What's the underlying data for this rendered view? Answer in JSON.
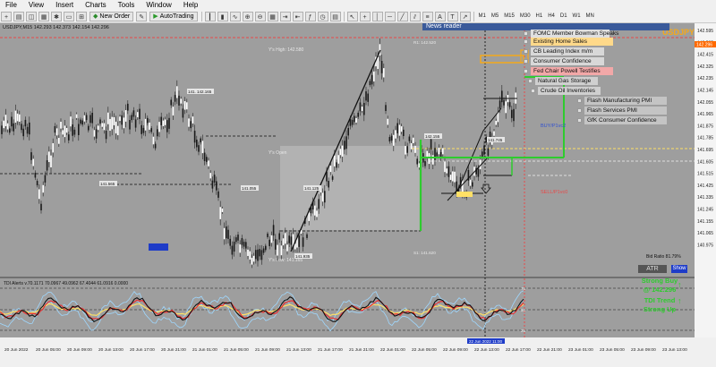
{
  "menu": [
    "File",
    "View",
    "Insert",
    "Charts",
    "Tools",
    "Window",
    "Help"
  ],
  "toolbar": {
    "new_order": "New Order",
    "autotrading": "AutoTrading",
    "timeframes": [
      "M1",
      "M5",
      "M15",
      "M30",
      "H1",
      "H4",
      "D1",
      "W1",
      "MN"
    ]
  },
  "chart": {
    "title": "USDJPY,M15  142.293 142.373 142.154 142.296",
    "symbol_watermark": "USDJPY",
    "prices": [
      "142.595",
      "142.505",
      "142.415",
      "142.325",
      "142.235",
      "142.145",
      "142.055",
      "141.965",
      "141.875",
      "141.785",
      "141.695",
      "141.605",
      "141.515",
      "141.425",
      "141.335",
      "141.245",
      "141.155",
      "141.065",
      "140.975"
    ],
    "price_tag": "142.296",
    "times": [
      "20 Jun 2022",
      "20 Jun 05:00",
      "20 Jun 09:00",
      "20 Jun 13:00",
      "20 Jun 17:00",
      "20 Jun 21:00",
      "21 Jun 01:00",
      "21 Jun 05:00",
      "21 Jun 09:00",
      "21 Jun 13:00",
      "21 Jun 17:00",
      "21 Jun 21:00",
      "22 Jun 01:00",
      "22 Jun 05:00",
      "22 Jun 09:00",
      "22 Jun 13:00",
      "22 Jun 17:00",
      "22 Jun 21:00",
      "23 Jun 01:00",
      "23 Jun 05:00",
      "23 Jun 09:00",
      "23 Jun 13:00"
    ],
    "levels": {
      "y_high": "Y's High: 142.580",
      "y_open": "Y's Open",
      "y_low": "Y's Low: 141.165",
      "r1": "R1: 142.520",
      "s1": "S1: 141.620",
      "buy": "BUY/P1vc2",
      "sell": "SELL/P1vc0",
      "bid_ratio": "Bid Ratio 81.79%"
    },
    "tags": [
      "141.565",
      "141.805",
      "142.165",
      "142.155",
      "141.745",
      "141.935",
      "141.055",
      "141.125"
    ],
    "cursor_time": "22 Jun 2022 11:00"
  },
  "news": {
    "title": "News reader",
    "items": [
      "FOMC Member Bowman Speaks",
      "Existing Home Sales",
      "CB Leading Index m/m",
      "Consumer Confidence",
      "Fed Chair Powell Testifies",
      "Natural Gas Storage",
      "Crude Oil Inventories",
      "Flash Manufacturing PMI",
      "Flash Services PMI",
      "GfK Consumer Confidence"
    ]
  },
  "indicator": {
    "title": "TDI Alerts v.70.1171 70.0967 49.0962 67.4044 61.0916 0.0000",
    "levels": [
      "75",
      "50",
      "25"
    ]
  },
  "signals": {
    "strong_buy": "Strong Buy",
    "price": "@ 142.296",
    "tdi_trend": "TDI Trend",
    "strong_up": "Strong Up"
  },
  "buttons": {
    "atr": "ATR",
    "show": "Show"
  },
  "colors": {
    "bg": "#9e9e9e",
    "up": "#2ecc2e",
    "sell": "#e84848",
    "buy": "#3050d0"
  }
}
